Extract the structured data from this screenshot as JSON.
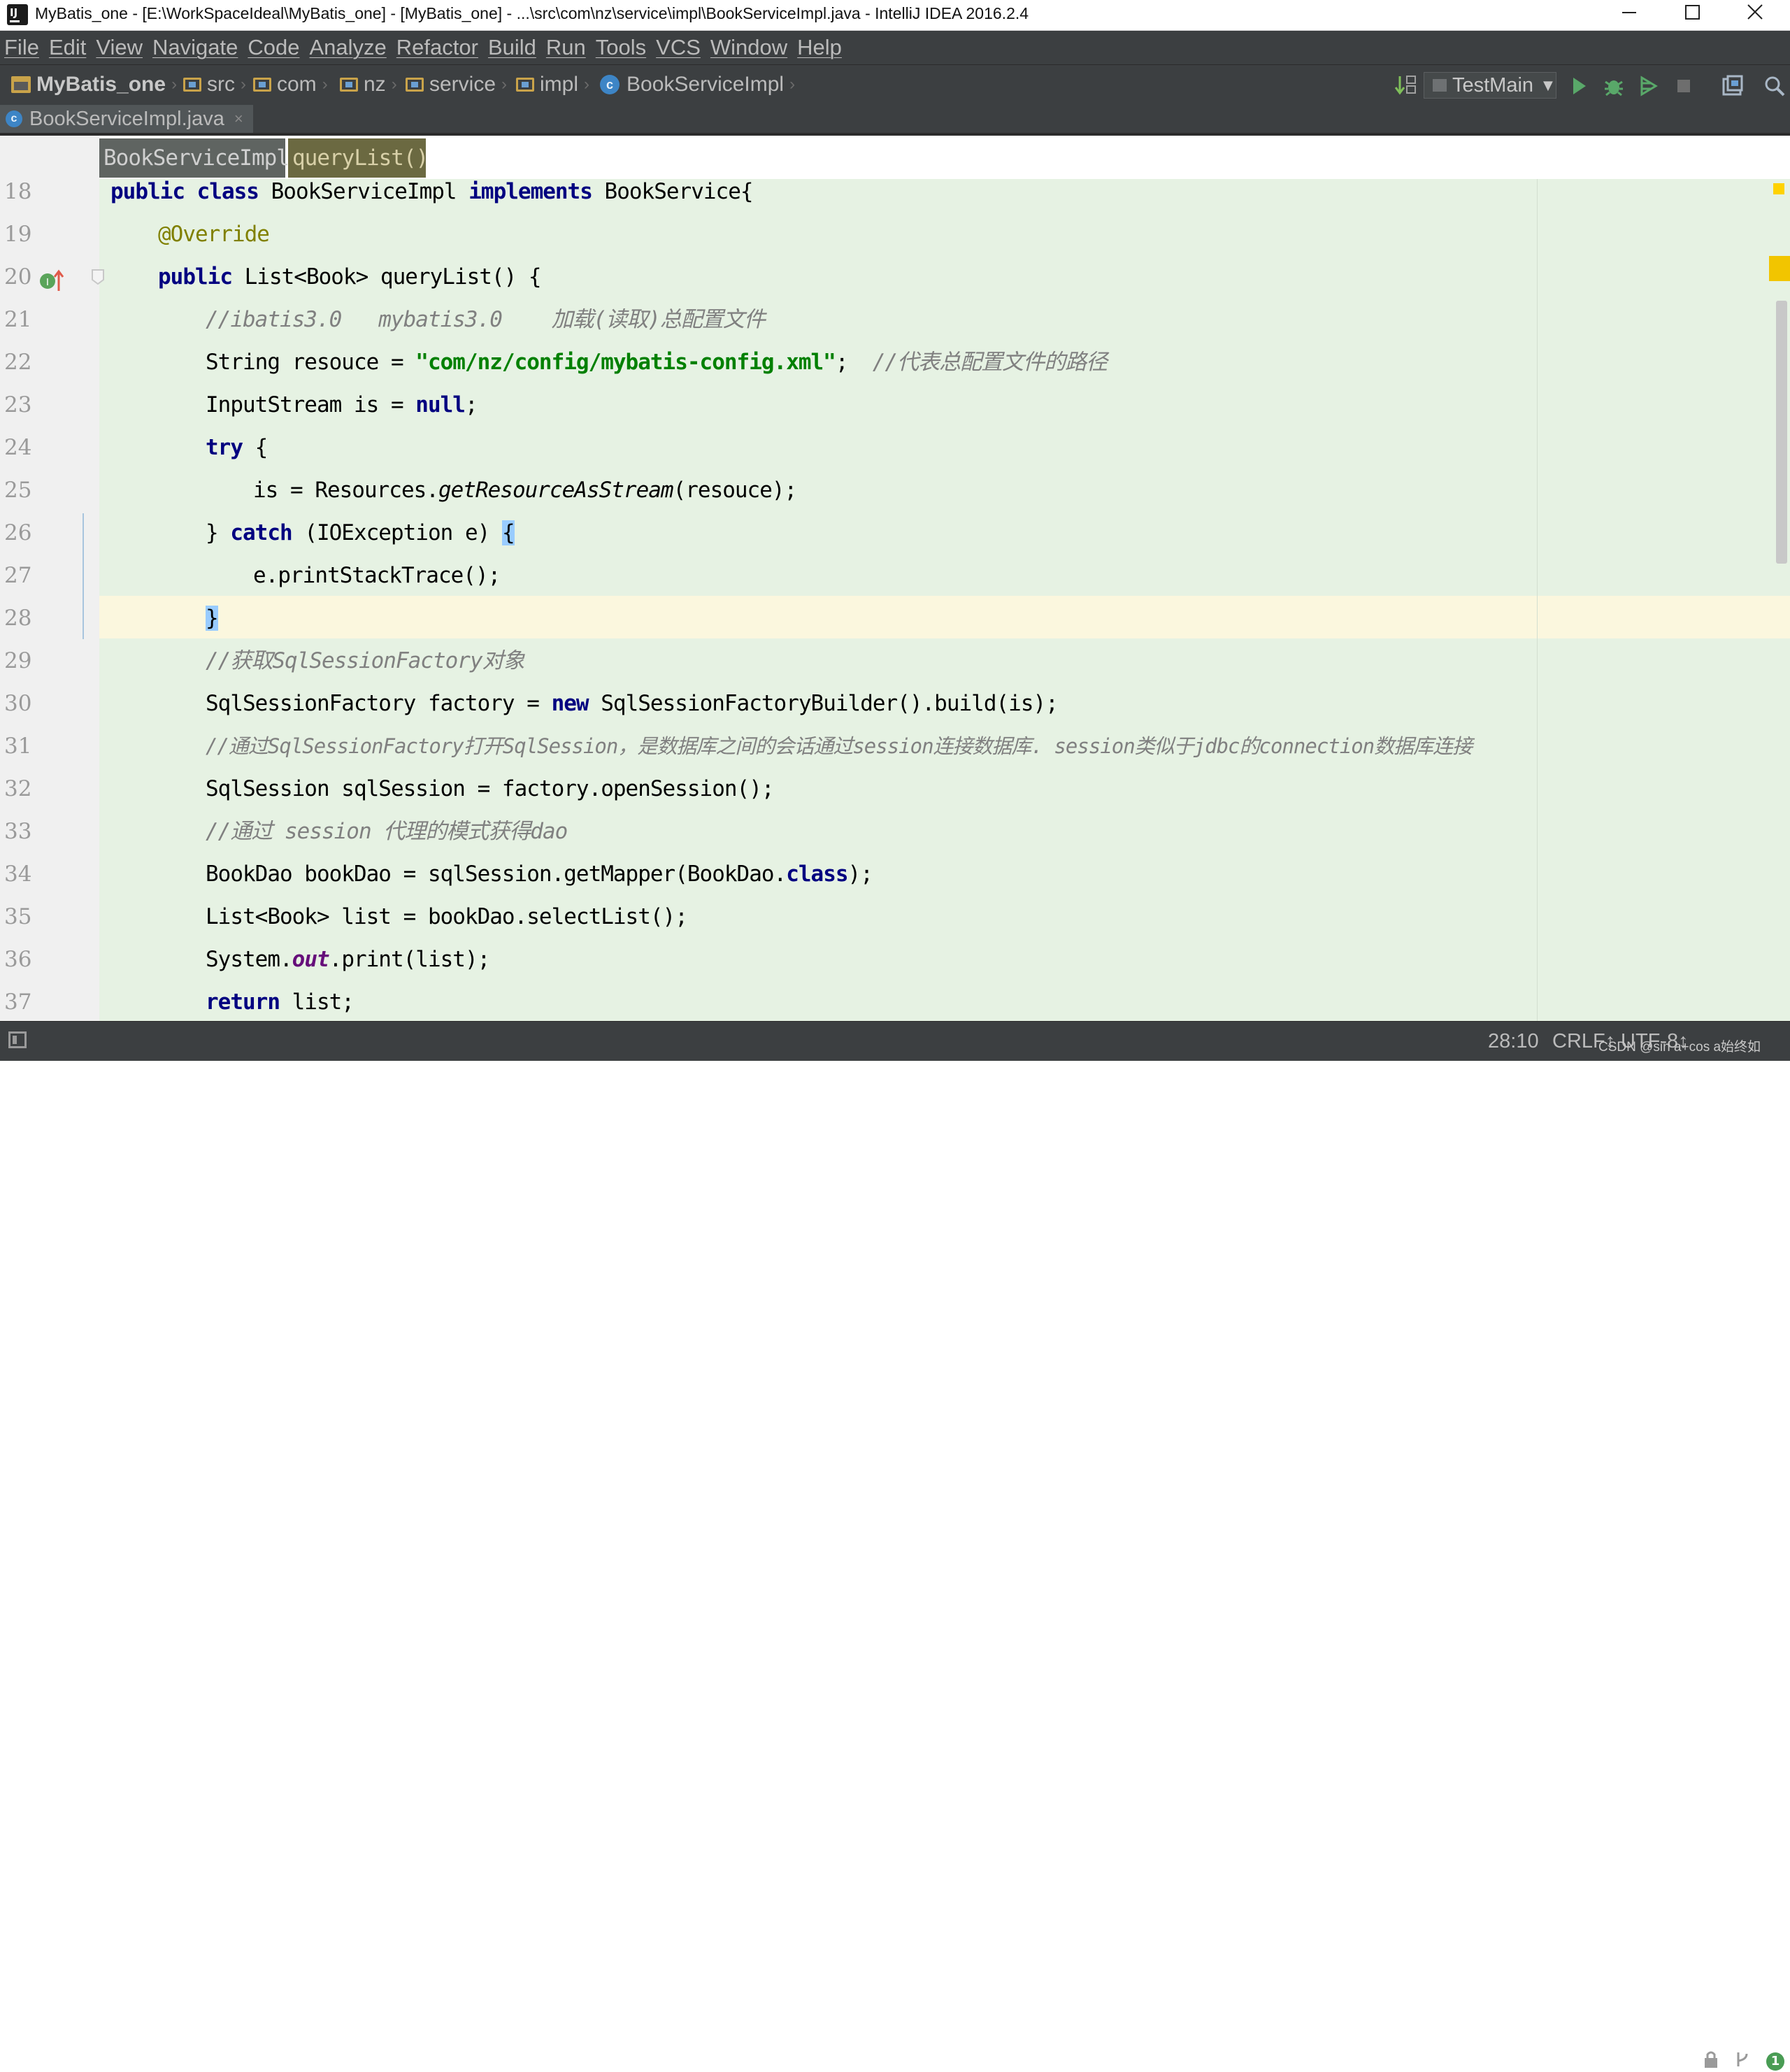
{
  "window": {
    "title": "MyBatis_one - [E:\\WorkSpaceIdeal\\MyBatis_one] - [MyBatis_one] - ...\\src\\com\\nz\\service\\impl\\BookServiceImpl.java - IntelliJ IDEA 2016.2.4",
    "app_icon_text": "IJ"
  },
  "menu": [
    "File",
    "Edit",
    "View",
    "Navigate",
    "Code",
    "Analyze",
    "Refactor",
    "Build",
    "Run",
    "Tools",
    "VCS",
    "Window",
    "Help"
  ],
  "navbar": {
    "project": "MyBatis_one",
    "crumbs": [
      "src",
      "com",
      "nz",
      "service",
      "impl"
    ],
    "class_crumb": "BookServiceImpl",
    "run_config": "TestMain"
  },
  "tab": {
    "file_name": "BookServiceImpl.java",
    "close_glyph": "×",
    "icon_letter": "c"
  },
  "editor_breadcrumb": {
    "class": "BookServiceImpl",
    "method": "queryList()"
  },
  "code": {
    "line_numbers": [
      "18",
      "19",
      "20",
      "21",
      "22",
      "23",
      "24",
      "25",
      "26",
      "27",
      "28",
      "29",
      "30",
      "31",
      "32",
      "33",
      "34",
      "35",
      "36",
      "37"
    ],
    "l18": {
      "kw1": "public class",
      "name": " BookServiceImpl ",
      "kw2": "implements",
      "rest": " BookService{"
    },
    "l19": {
      "ann": "@Override"
    },
    "l20": {
      "kw": "public",
      "rest": " List<Book> queryList() {"
    },
    "l21": {
      "cmt": "//ibatis3.0   mybatis3.0    加载(读取)总配置文件"
    },
    "l22": {
      "pre": "String resouce = ",
      "str": "\"com/nz/config/mybatis-config.xml\"",
      "mid": ";  ",
      "cmt": "//代表总配置文件的路径"
    },
    "l23": {
      "pre": "InputStream is = ",
      "kw": "null",
      "post": ";"
    },
    "l24": {
      "kw": "try",
      "rest": " {"
    },
    "l25": {
      "pre": "is = Resources.",
      "st": "getResourceAsStream",
      "post": "(resouce);"
    },
    "l26": {
      "pre": "} ",
      "kw": "catch",
      "mid": " (IOException e) ",
      "brace": "{"
    },
    "l27": {
      "text": "e.printStackTrace();"
    },
    "l28": {
      "brace": "}"
    },
    "l29": {
      "cmt": "//获取SqlSessionFactory对象"
    },
    "l30": {
      "pre": "SqlSessionFactory factory = ",
      "kw": "new",
      "post": " SqlSessionFactoryBuilder().build(is);"
    },
    "l31": {
      "cmt": "//通过SqlSessionFactory打开SqlSession，是数据库之间的会话通过session连接数据库. session类似于jdbc的connection数据库连接"
    },
    "l32": {
      "text": "SqlSession sqlSession = factory.openSession();"
    },
    "l33": {
      "cmt": "//通过 session 代理的模式获得dao"
    },
    "l34": {
      "pre": "BookDao bookDao = sqlSession.getMapper(BookDao.",
      "kw": "class",
      "post": ");"
    },
    "l35": {
      "text": "List<Book> list = bookDao.selectList();"
    },
    "l36": {
      "pre": "System.",
      "fld": "out",
      "post": ".print(list);"
    },
    "l37": {
      "kw": "return",
      "post": " list;"
    }
  },
  "status": {
    "position": "28:10",
    "line_separator": "CRLF↕",
    "encoding": "UTF-8↕",
    "event_count": "1",
    "watermark": "CSDN @sin a+cos a始终如"
  },
  "colors": {
    "editor_bg": "#e6f2e3",
    "caret_line": "#fbf7de",
    "keyword": "#000080",
    "string": "#008000",
    "comment": "#808080",
    "annotation": "#808000",
    "chrome_bg": "#3c3f41"
  }
}
